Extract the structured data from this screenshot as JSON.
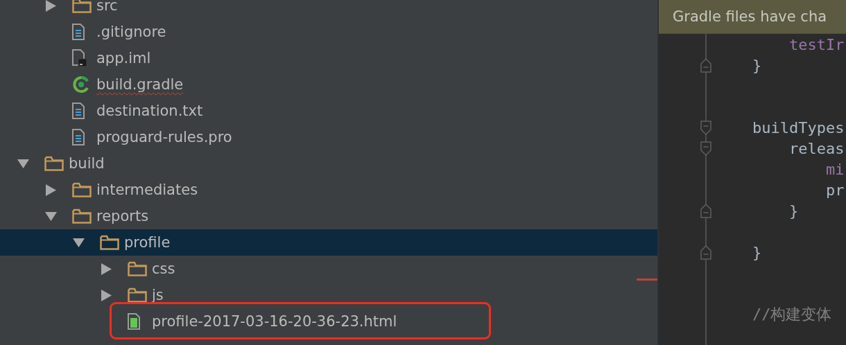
{
  "project_tree": [
    {
      "children": [
        {
          "label": "src",
          "kind": "folder",
          "expanded": false
        },
        {
          "label": ".gitignore",
          "kind": "text-file"
        },
        {
          "label": "app.iml",
          "kind": "module-file"
        },
        {
          "label": "build.gradle",
          "kind": "gradle-file",
          "misspelled": true
        },
        {
          "label": "destination.txt",
          "kind": "text-file"
        },
        {
          "label": "proguard-rules.pro",
          "kind": "text-file"
        }
      ]
    },
    {
      "label": "build",
      "kind": "folder",
      "expanded": true,
      "children": [
        {
          "label": "intermediates",
          "kind": "folder",
          "expanded": false
        },
        {
          "label": "reports",
          "kind": "folder",
          "expanded": true,
          "children": [
            {
              "label": "profile",
              "kind": "folder",
              "expanded": true,
              "selected": true,
              "children": [
                {
                  "label": "css",
                  "kind": "folder",
                  "expanded": false
                },
                {
                  "label": "js",
                  "kind": "folder",
                  "expanded": false
                },
                {
                  "label": "profile-2017-03-16-20-36-23.html",
                  "kind": "html-file",
                  "highlighted": true
                }
              ]
            }
          ]
        }
      ]
    }
  ],
  "editor": {
    "banner": "Gradle files have cha",
    "lines": [
      {
        "kind": "block",
        "children": [
          {
            "kind": "code",
            "fold_start": false,
            "fold_end": false,
            "tokens": [
              {
                "text": "testIr",
                "kind": "field"
              }
            ]
          }
        ]
      },
      {
        "kind": "code",
        "fold_start": false,
        "fold_end": true,
        "tokens": [
          {
            "text": "}",
            "kind": "plain"
          }
        ]
      },
      {
        "kind": "blank"
      },
      {
        "kind": "blank"
      },
      {
        "kind": "code",
        "fold_start": true,
        "fold_end": false,
        "tokens": [
          {
            "text": "buildTypes",
            "kind": "plain"
          }
        ],
        "children": [
          {
            "kind": "code",
            "fold_start": true,
            "fold_end": false,
            "tokens": [
              {
                "text": "releas",
                "kind": "plain"
              }
            ],
            "children": [
              {
                "kind": "code",
                "fold_start": false,
                "fold_end": false,
                "tokens": [
                  {
                    "text": "mi",
                    "kind": "field"
                  }
                ]
              },
              {
                "kind": "code",
                "fold_start": false,
                "fold_end": false,
                "tokens": [
                  {
                    "text": "pr",
                    "kind": "plain"
                  }
                ]
              }
            ]
          },
          {
            "kind": "code",
            "fold_start": false,
            "fold_end": true,
            "tokens": [
              {
                "text": "}",
                "kind": "plain"
              }
            ]
          }
        ]
      },
      {
        "kind": "blank"
      },
      {
        "kind": "code",
        "fold_start": false,
        "fold_end": true,
        "tokens": [
          {
            "text": "}",
            "kind": "plain"
          }
        ]
      },
      {
        "kind": "blank"
      },
      {
        "kind": "blank"
      },
      {
        "kind": "code",
        "fold_start": false,
        "fold_end": false,
        "tokens": [
          {
            "text": "//构建变体",
            "kind": "comment"
          }
        ]
      }
    ]
  }
}
